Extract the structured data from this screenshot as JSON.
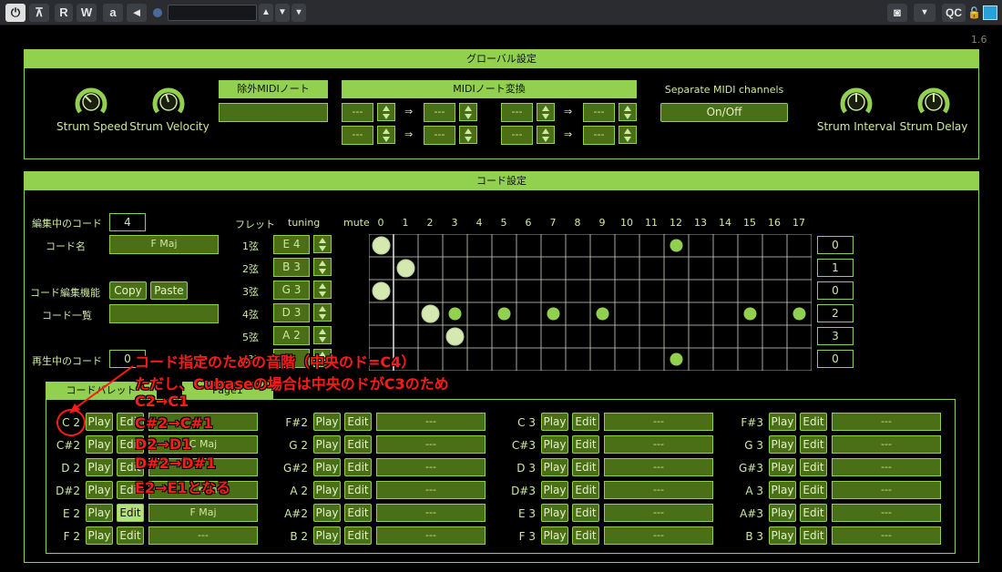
{
  "toolbar": {
    "power": "⏻",
    "unlock": "⊼",
    "read": "R",
    "write": "W",
    "auto": "a",
    "back": "◄",
    "qc": "QC",
    "version": "1.6"
  },
  "global": {
    "title": "グローバル設定",
    "strum_speed": "Strum Speed",
    "strum_velocity": "Strum Velocity",
    "exclude_midi": "除外MIDIノート",
    "midi_convert": "MIDIノート変換",
    "separate_channels": "Separate MIDI channels",
    "onoff": "On/Off",
    "strum_interval": "Strum Interval",
    "strum_delay": "Strum Delay",
    "dash": "---",
    "arrow": "⇒"
  },
  "chord": {
    "title": "コード設定",
    "editing_label": "編集中のコード",
    "editing_value": "4",
    "name_label": "コード名",
    "name_value": "F Maj",
    "edit_func_label": "コード編集機能",
    "copy": "Copy",
    "paste": "Paste",
    "list_label": "コード一覧",
    "playing_label": "再生中のコード",
    "playing_value": "0",
    "fret_label": "フレット",
    "tuning_label": "tuning",
    "mute_label": "mute",
    "fret_numbers": [
      "0",
      "1",
      "2",
      "3",
      "4",
      "5",
      "6",
      "7",
      "8",
      "9",
      "10",
      "11",
      "12",
      "13",
      "14",
      "15",
      "16",
      "17"
    ],
    "strings": [
      {
        "label": "1弦",
        "tuning": "E 4",
        "fret": "0"
      },
      {
        "label": "2弦",
        "tuning": "B 3",
        "fret": "1"
      },
      {
        "label": "3弦",
        "tuning": "G 3",
        "fret": "0"
      },
      {
        "label": "4弦",
        "tuning": "D 3",
        "fret": "2"
      },
      {
        "label": "5弦",
        "tuning": "A 2",
        "fret": "3"
      },
      {
        "label": "6弦",
        "tuning": "",
        "fret": "0"
      }
    ],
    "palette_tab": "コードパレット",
    "page_tab": "Page1",
    "play": "Play",
    "edit": "Edit",
    "palette": [
      {
        "note": "C 2",
        "chord": ""
      },
      {
        "note": "C#2",
        "chord": "C Maj"
      },
      {
        "note": "D 2",
        "chord": ""
      },
      {
        "note": "D#2",
        "chord": "E min"
      },
      {
        "note": "E 2",
        "chord": "F Maj"
      },
      {
        "note": "F 2",
        "chord": "---"
      },
      {
        "note": "F#2",
        "chord": "---"
      },
      {
        "note": "G 2",
        "chord": "---"
      },
      {
        "note": "G#2",
        "chord": "---"
      },
      {
        "note": "A 2",
        "chord": "---"
      },
      {
        "note": "A#2",
        "chord": "---"
      },
      {
        "note": "B 2",
        "chord": "---"
      },
      {
        "note": "C 3",
        "chord": "---"
      },
      {
        "note": "C#3",
        "chord": "---"
      },
      {
        "note": "D 3",
        "chord": "---"
      },
      {
        "note": "D#3",
        "chord": "---"
      },
      {
        "note": "E 3",
        "chord": "---"
      },
      {
        "note": "F 3",
        "chord": "---"
      },
      {
        "note": "F#3",
        "chord": "---"
      },
      {
        "note": "G 3",
        "chord": "---"
      },
      {
        "note": "G#3",
        "chord": "---"
      },
      {
        "note": "A 3",
        "chord": "---"
      },
      {
        "note": "A#3",
        "chord": "---"
      },
      {
        "note": "B 3",
        "chord": "---"
      }
    ]
  },
  "fret_dots": [
    {
      "string": 1,
      "fret": 0,
      "kind": "open"
    },
    {
      "string": 1,
      "fret": 12,
      "kind": "marker"
    },
    {
      "string": 2,
      "fret": 1,
      "kind": "pressed"
    },
    {
      "string": 3,
      "fret": 0,
      "kind": "open"
    },
    {
      "string": 4,
      "fret": 3,
      "kind": "marker"
    },
    {
      "string": 4,
      "fret": 5,
      "kind": "marker"
    },
    {
      "string": 4,
      "fret": 7,
      "kind": "marker"
    },
    {
      "string": 4,
      "fret": 9,
      "kind": "marker"
    },
    {
      "string": 4,
      "fret": 15,
      "kind": "marker"
    },
    {
      "string": 4,
      "fret": 17,
      "kind": "marker"
    },
    {
      "string": 4,
      "fret": 2,
      "kind": "pressed"
    },
    {
      "string": 5,
      "fret": 3,
      "kind": "pressed"
    },
    {
      "string": 6,
      "fret": 12,
      "kind": "marker"
    }
  ],
  "annotation": {
    "line1": "コード指定のための音階（中央のド=C4）",
    "line2": "ただし、Cubaseの場合は中央のドがC3のため",
    "line3": "C2→C1",
    "line4": "C#2→C#1",
    "line5": "D2→D1",
    "line6": "D#2→D#1",
    "line7": "E2→E1となる"
  },
  "colors": {
    "accent": "#92d050",
    "field": "#4a6f16",
    "annotation": "#ff1a1a"
  }
}
